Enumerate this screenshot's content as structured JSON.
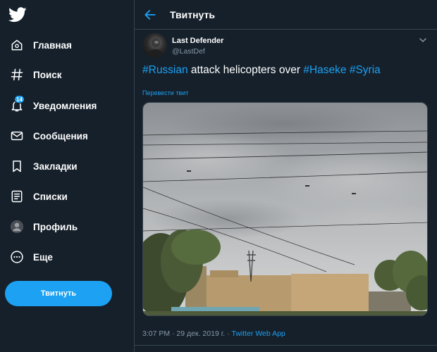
{
  "app": {
    "logo_icon": "twitter-bird-icon",
    "accent": "#1da1f2",
    "background": "#15202b"
  },
  "sidebar": {
    "items": [
      {
        "label": "Главная",
        "icon": "home-icon"
      },
      {
        "label": "Поиск",
        "icon": "hashtag-icon"
      },
      {
        "label": "Уведомления",
        "icon": "bell-icon",
        "badge": "14"
      },
      {
        "label": "Сообщения",
        "icon": "envelope-icon"
      },
      {
        "label": "Закладки",
        "icon": "bookmark-icon"
      },
      {
        "label": "Списки",
        "icon": "list-icon"
      },
      {
        "label": "Профиль",
        "icon": "avatar-icon"
      },
      {
        "label": "Еще",
        "icon": "more-icon"
      }
    ],
    "tweet_button": "Твитнуть"
  },
  "header": {
    "title": "Твитнуть",
    "back_icon": "back-arrow-icon"
  },
  "tweet": {
    "author_name": "Last Defender",
    "author_handle": "@LastDef",
    "text_parts": [
      {
        "text": "#Russian",
        "hashtag": true
      },
      {
        "text": " attack helicopters over ",
        "hashtag": false
      },
      {
        "text": "#Haseke",
        "hashtag": true
      },
      {
        "text": " ",
        "hashtag": false
      },
      {
        "text": "#Syria",
        "hashtag": true
      }
    ],
    "translate_label": "Перевести твит",
    "time": "3:07 PM · 29 дек. 2019 г. · ",
    "source": "Twitter Web App"
  }
}
